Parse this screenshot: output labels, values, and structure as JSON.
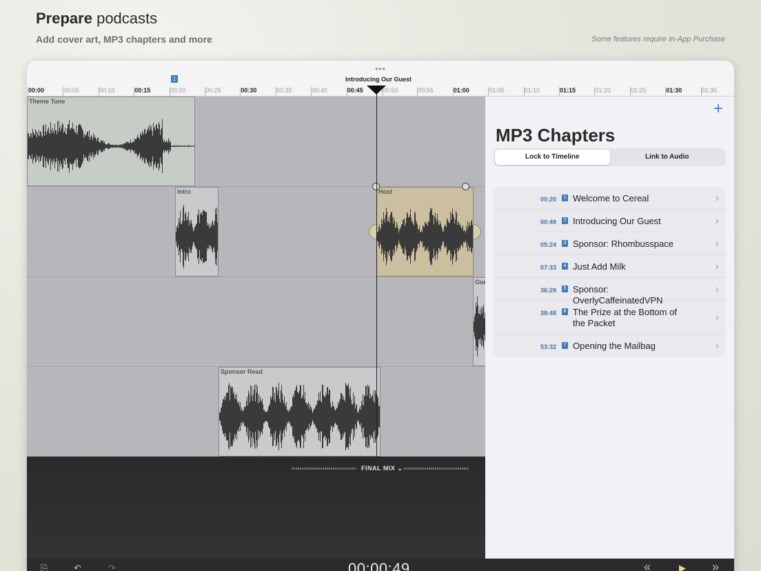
{
  "hero": {
    "title_bold": "Prepare",
    "title_light": "podcasts",
    "subtitle": "Add cover art, MP3 chapters and more",
    "note": "Some features require In-App Purchase"
  },
  "device": {
    "grab": "•••"
  },
  "ruler": {
    "marker_number": "1",
    "current_chapter": "Introducing Our Guest",
    "ticks": [
      "00:00",
      "00:05",
      "00:10",
      "00:15",
      "00:20",
      "00:25",
      "00:30",
      "00:35",
      "00:40",
      "00:45",
      "00:50",
      "00:55",
      "01:00",
      "01:05",
      "01:10",
      "01:15",
      "01:20",
      "01:25",
      "01:30",
      "01:35"
    ]
  },
  "tracks": {
    "theme": "Theme Tune",
    "intro": "Intro",
    "host": "Host",
    "guest": "Gue",
    "sponsor": "Sponsor Read"
  },
  "mixer": {
    "label": "FINAL MIX",
    "chevron": "⌄"
  },
  "transport": {
    "time": "00:00:49",
    "share_icon": "⎘",
    "undo_icon": "↶",
    "redo_icon": "↷",
    "rewind_icon": "«",
    "play_icon": "▶",
    "forward_icon": "»"
  },
  "panel": {
    "add": "+",
    "title": "MP3 Chapters",
    "seg_lock": "Lock to Timeline",
    "seg_link": "Link to Audio",
    "chapters": [
      {
        "time": "00:20",
        "num": "1",
        "title": "Welcome to Cereal"
      },
      {
        "time": "00:49",
        "num": "2",
        "title": "Introducing Our Guest"
      },
      {
        "time": "05:24",
        "num": "3",
        "title": "Sponsor: Rhombusspace"
      },
      {
        "time": "07:33",
        "num": "4",
        "title": "Just Add Milk"
      },
      {
        "time": "36:29",
        "num": "5",
        "title": "Sponsor: OverlyCaffeinatedVPN"
      },
      {
        "time": "38:48",
        "num": "6",
        "title": "The Prize at the Bottom of the Packet"
      },
      {
        "time": "53:32",
        "num": "7",
        "title": "Opening the Mailbag"
      }
    ],
    "chevron": "›"
  },
  "colors": {
    "accent": "#3f7bb6",
    "link": "#3b7dd0"
  }
}
